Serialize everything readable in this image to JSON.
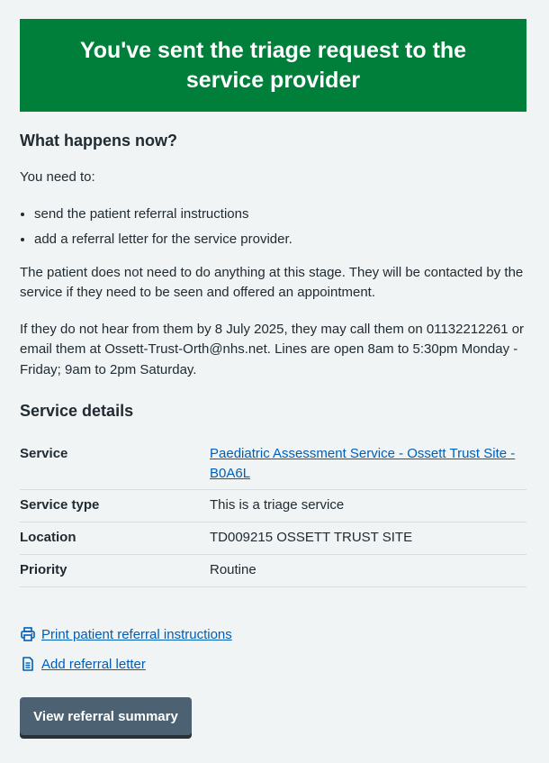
{
  "panel": {
    "title": "You've sent the triage request to the service provider"
  },
  "what_happens": {
    "heading": "What happens now?",
    "intro": "You need to:",
    "items": [
      "send the patient referral instructions",
      "add a referral letter for the service provider."
    ],
    "patient_note": "The patient does not need to do anything at this stage. They will be contacted by the service if they need to be seen and offered an appointment.",
    "contact_note": "If they do not hear from them by 8 July 2025, they may call them on 01132212261 or email them at Ossett-Trust-Orth@nhs.net. Lines are open 8am to 5:30pm Monday - Friday; 9am to 2pm Saturday."
  },
  "service_details": {
    "heading": "Service details",
    "rows": [
      {
        "key": "Service",
        "value": "Paediatric Assessment Service - Ossett Trust Site - B0A6L"
      },
      {
        "key": "Service type",
        "value": "This is a triage service"
      },
      {
        "key": "Location",
        "value": "TD009215 OSSETT TRUST SITE"
      },
      {
        "key": "Priority",
        "value": "Routine"
      }
    ]
  },
  "actions": {
    "print_label": "Print patient referral instructions",
    "print_icon": "printer-icon",
    "letter_label": "Add referral letter",
    "letter_icon": "document-icon"
  },
  "button": {
    "label": "View referral summary"
  },
  "colors": {
    "panel_green": "#007f3b",
    "link_blue": "#005eb8",
    "button_grey": "#4c6272",
    "background": "#f0f4f5"
  }
}
